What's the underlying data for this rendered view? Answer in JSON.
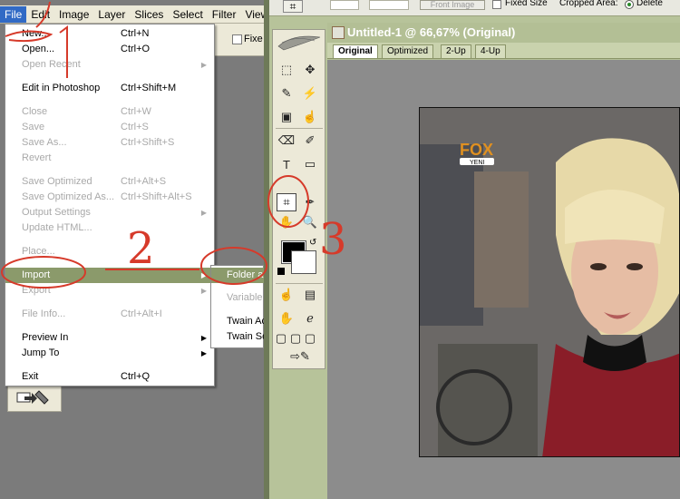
{
  "menubar": {
    "items": [
      "File",
      "Edit",
      "Image",
      "Layer",
      "Slices",
      "Select",
      "Filter",
      "View"
    ]
  },
  "left_toolbar": {
    "fixed_label": "Fixe"
  },
  "file_menu": {
    "items": [
      {
        "label": "New...",
        "shortcut": "Ctrl+N"
      },
      {
        "label": "Open...",
        "shortcut": "Ctrl+O"
      },
      {
        "label": "Open Recent",
        "shortcut": ""
      },
      {
        "label": "Edit in Photoshop",
        "shortcut": "Ctrl+Shift+M"
      },
      {
        "label": "Close",
        "shortcut": "Ctrl+W"
      },
      {
        "label": "Save",
        "shortcut": "Ctrl+S"
      },
      {
        "label": "Save As...",
        "shortcut": "Ctrl+Shift+S"
      },
      {
        "label": "Revert",
        "shortcut": ""
      },
      {
        "label": "Save Optimized",
        "shortcut": "Ctrl+Alt+S"
      },
      {
        "label": "Save Optimized As...",
        "shortcut": "Ctrl+Shift+Alt+S"
      },
      {
        "label": "Output Settings",
        "shortcut": ""
      },
      {
        "label": "Update HTML...",
        "shortcut": ""
      },
      {
        "label": "Place...",
        "shortcut": ""
      },
      {
        "label": "Import",
        "shortcut": ""
      },
      {
        "label": "Export",
        "shortcut": ""
      },
      {
        "label": "File Info...",
        "shortcut": "Ctrl+Alt+I"
      },
      {
        "label": "Preview In",
        "shortcut": ""
      },
      {
        "label": "Jump To",
        "shortcut": ""
      },
      {
        "label": "Exit",
        "shortcut": "Ctrl+Q"
      }
    ]
  },
  "import_submenu": {
    "items": [
      "Folder a",
      "Variable",
      "Twain Ac",
      "Twain Se"
    ]
  },
  "right_properties": {
    "front_image": "Front Image",
    "fixed_size": "Fixed Size",
    "cropped_area": "Cropped Area:",
    "delete": "Delete"
  },
  "document": {
    "title": "Untitled-1 @ 66,67% (Original)",
    "tabs": [
      "Original",
      "Optimized",
      "2-Up",
      "4-Up"
    ],
    "active_tab": "Original"
  },
  "photo": {
    "logo_text": "FOX",
    "logo_sub": "YENI"
  },
  "annotations": [
    "1",
    "2",
    "3"
  ],
  "colors": {
    "menu_highlight": "#8b9a6b",
    "foreground": "#000000",
    "background": "#ffffff",
    "annotation": "#d63a2a"
  }
}
